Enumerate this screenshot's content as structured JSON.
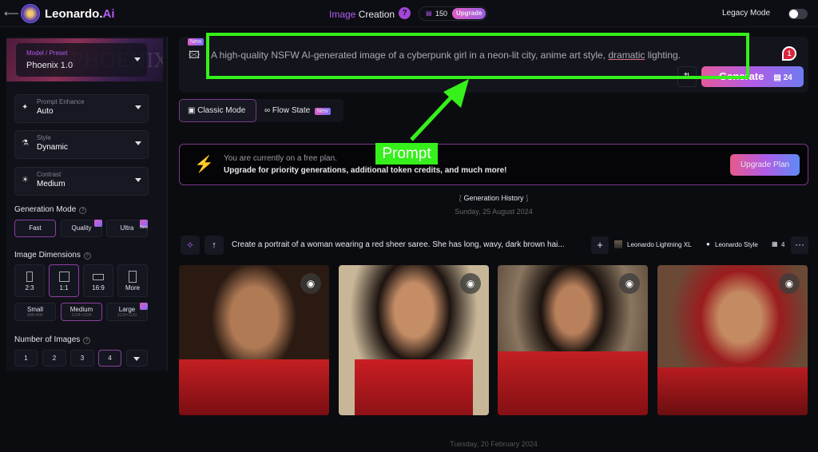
{
  "topbar": {
    "brand": "Leonardo.",
    "brand_ai": "Ai",
    "title_accent": "Image",
    "title": "Creation",
    "help": "?",
    "tokens": "150",
    "upgrade": "Upgrade",
    "legacy_mode": "Legacy Mode",
    "legacy_on": false
  },
  "sidebar": {
    "model": {
      "label": "Model / Preset",
      "value": "Phoenix 1.0",
      "bg_text": "PHOENIX"
    },
    "prompt_enhance": {
      "label": "Prompt Enhance",
      "value": "Auto"
    },
    "style": {
      "label": "Style",
      "value": "Dynamic"
    },
    "contrast": {
      "label": "Contrast",
      "value": "Medium"
    },
    "generation_mode": {
      "title": "Generation Mode",
      "options": [
        "Fast",
        "Quality",
        "Ultra"
      ],
      "selected": "Fast",
      "ultra_badge": "New"
    },
    "dimensions": {
      "title": "Image Dimensions",
      "ratios": [
        "2:3",
        "1:1",
        "16:9",
        "More"
      ],
      "selected_ratio": "1:1",
      "sizes": [
        {
          "name": "Small",
          "px": "896×896"
        },
        {
          "name": "Medium",
          "px": "1024×1024"
        },
        {
          "name": "Large",
          "px": "1120×1120"
        }
      ],
      "selected_size": "Medium"
    },
    "num_images": {
      "title": "Number of Images",
      "options": [
        "1",
        "2",
        "3",
        "4"
      ],
      "selected": "4"
    }
  },
  "prompt": {
    "new_badge": "New",
    "text_before": "A high-quality NSFW AI-generated image of a cyberpunk girl in a neon-lit city, anime art style, ",
    "text_underlined": "dramatic",
    "text_after": " lighting.",
    "notification_count": "1",
    "generate": "Generate",
    "generate_cost": "24"
  },
  "modes": {
    "classic": "Classic Mode",
    "flow": "Flow State",
    "flow_badge": "New"
  },
  "annotation": {
    "label": "Prompt",
    "color": "#35f01a"
  },
  "banner": {
    "line1": "You are currently on a free plan.",
    "line2": "Upgrade for priority generations, additional token credits, and much more!",
    "button": "Upgrade Plan"
  },
  "history": {
    "title": "Generation History",
    "date1": "Sunday, 25 August 2024",
    "date2": "Tuesday, 20 February 2024",
    "item": {
      "prompt": "Create a portrait of a woman wearing a red sheer saree. She has long, wavy, dark brown hai...",
      "model": "Leonardo Lightning XL",
      "style": "Leonardo Style",
      "count": "4"
    }
  }
}
